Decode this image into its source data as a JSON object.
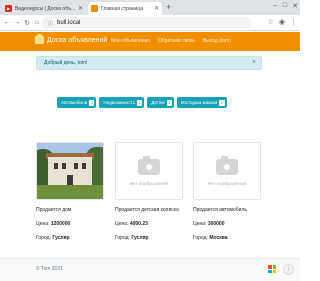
{
  "browser": {
    "tabs": [
      {
        "title": "Видеокурсы | Доска объ...",
        "favicon": "video-favicon"
      },
      {
        "title": "Главная страница",
        "favicon": "site-favicon"
      }
    ],
    "new_tab": "+",
    "url": "bull.local"
  },
  "header": {
    "brand": "Доска объявлений",
    "menu": [
      "Мои объявления",
      "Обратная связь",
      "Выход (tom)"
    ],
    "bg_color": "#f28f00"
  },
  "alert": {
    "text": "Добрый день, tom!",
    "close": "×"
  },
  "categories": [
    {
      "label": "Автомобили",
      "count": "2"
    },
    {
      "label": "Недвижимость",
      "count": "1"
    },
    {
      "label": "Детям",
      "count": "1"
    },
    {
      "label": "Молодым мамам",
      "count": "1"
    }
  ],
  "cards": [
    {
      "title": "Продается дом",
      "price_label": "Цена:",
      "price": "1200000",
      "city_label": "Город:",
      "city": "Гусляр",
      "image": "house-photo"
    },
    {
      "title": "Продается детская коляска",
      "price_label": "Цена:",
      "price": "4000.23",
      "city_label": "Город:",
      "city": "Гусляр",
      "image": "no-image",
      "noimg_text": "Нет изображения"
    },
    {
      "title": "Продается автомобиль",
      "price_label": "Цена:",
      "price": "300000",
      "city_label": "Город:",
      "city": "Москва",
      "image": "no-image",
      "noimg_text": "Нет изображения"
    }
  ],
  "footer": {
    "text": "© Tom 2021",
    "scroll_top": "↑"
  }
}
